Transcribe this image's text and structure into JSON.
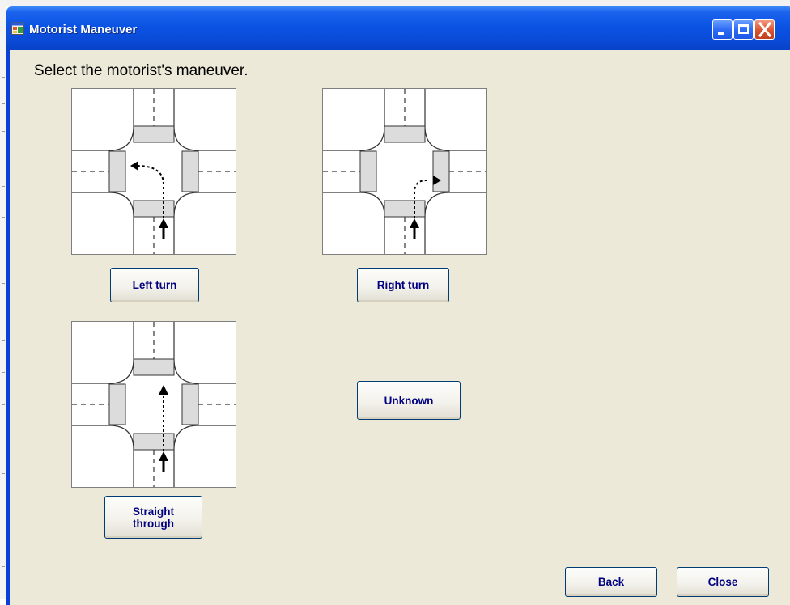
{
  "window": {
    "title": "Motorist Maneuver"
  },
  "titlebar": {
    "minimize_icon": "minimize-icon",
    "maximize_icon": "maximize-icon",
    "close_icon": "close-icon",
    "app_icon": "app-window-icon"
  },
  "instruction": "Select the motorist's maneuver.",
  "options": {
    "left_turn": {
      "label": "Left turn",
      "diagram_icon": "left-turn-diagram"
    },
    "right_turn": {
      "label": "Right turn",
      "diagram_icon": "right-turn-diagram"
    },
    "straight": {
      "label": "Straight\nthrough",
      "diagram_icon": "straight-through-diagram"
    },
    "unknown": {
      "label": "Unknown"
    }
  },
  "footer": {
    "back_label": "Back",
    "close_label": "Close"
  },
  "colors": {
    "titlebar": "#0a4bd8",
    "client_background": "#ece9d8",
    "button_text": "#000080",
    "crosswalk": "#dcdcdc"
  }
}
